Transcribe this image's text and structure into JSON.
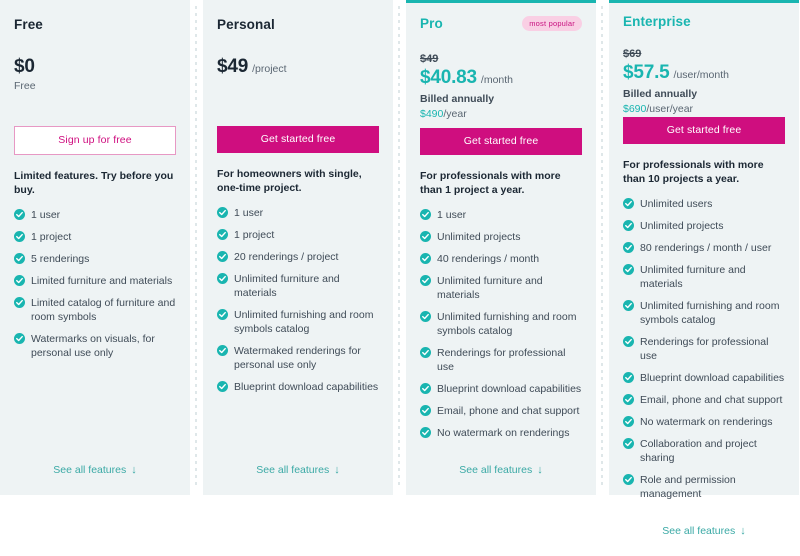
{
  "theme": {
    "card_bg": "#eef3f4",
    "page_bg": "#ffffff",
    "accent_teal": "#19b5b0",
    "accent_magenta": "#cf0e7f",
    "badge_bg": "#f9cfe4",
    "text_dark": "#1b2733",
    "text_body": "#3f4b57",
    "link_teal": "#3aa9a5"
  },
  "see_all_label": "See all features",
  "see_all_icon": "arrow-down-icon",
  "plans": [
    {
      "id": "free",
      "name": "Free",
      "highlight": false,
      "badge": null,
      "old_price": null,
      "price": "$0",
      "unit": null,
      "billing_note": "Free",
      "annual_price": null,
      "annual_unit": null,
      "cta_label": "Sign up for free",
      "cta_style": "outline",
      "tagline": "Limited features. Try before you buy.",
      "features": [
        "1 user",
        "1 project",
        "5 renderings",
        "Limited furniture and materials",
        "Limited catalog of furniture and room symbols",
        "Watermarks on visuals, for personal use only"
      ]
    },
    {
      "id": "personal",
      "name": "Personal",
      "highlight": false,
      "badge": null,
      "old_price": null,
      "price": "$49",
      "unit": "/project",
      "billing_note": null,
      "annual_price": null,
      "annual_unit": null,
      "cta_label": "Get started free",
      "cta_style": "solid",
      "tagline": "For homeowners with single, one-time project.",
      "features": [
        "1 user",
        "1 project",
        "20 renderings / project",
        "Unlimited furniture and materials",
        "Unlimited furnishing and room symbols catalog",
        "Watermaked renderings for personal use only",
        "Blueprint download capabilities"
      ]
    },
    {
      "id": "pro",
      "name": "Pro",
      "highlight": true,
      "badge": "most popular",
      "old_price": "$49",
      "price": "$40.83",
      "unit": "/month",
      "billing_note": "Billed annually",
      "annual_price": "$490",
      "annual_unit": "/year",
      "cta_label": "Get started free",
      "cta_style": "solid",
      "tagline": "For professionals with more than 1 project a year.",
      "features": [
        "1 user",
        "Unlimited projects",
        "40 renderings / month",
        "Unlimited furniture and materials",
        "Unlimited furnishing and room symbols catalog",
        "Renderings for professional use",
        "Blueprint download capabilities",
        "Email, phone and chat support",
        "No watermark on renderings"
      ]
    },
    {
      "id": "enterprise",
      "name": "Enterprise",
      "highlight": true,
      "badge": null,
      "old_price": "$69",
      "price": "$57.5",
      "unit": "/user/month",
      "billing_note": "Billed annually",
      "annual_price": "$690",
      "annual_unit": "/user/year",
      "cta_label": "Get started free",
      "cta_style": "solid",
      "tagline": "For professionals with more than 10 projects a year.",
      "features": [
        "Unlimited users",
        "Unlimited projects",
        "80 renderings / month / user",
        "Unlimited furniture and materials",
        "Unlimited furnishing and room symbols catalog",
        "Renderings for professional use",
        "Blueprint download capabilities",
        "Email, phone and chat support",
        "No watermark on renderings",
        "Collaboration and project sharing",
        "Role and permission management"
      ]
    }
  ]
}
